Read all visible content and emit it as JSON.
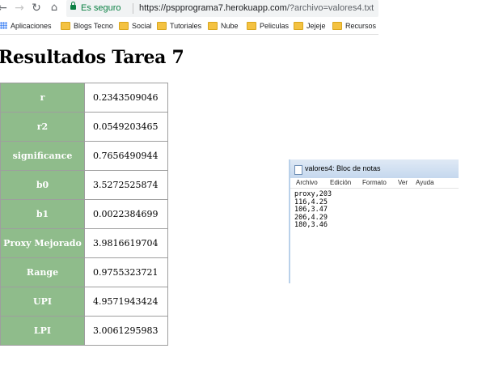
{
  "browser": {
    "security_text": "Es seguro",
    "url_host": "https://pspprograma7.herokuapp.com",
    "url_rest": "/?archivo=valores4.txt"
  },
  "bookmarks": [
    {
      "label": "Aplicaciones",
      "icon": "apps-icon"
    },
    {
      "label": "Blogs Tecno",
      "icon": "folder-icon"
    },
    {
      "label": "Social",
      "icon": "folder-icon"
    },
    {
      "label": "Tutoriales",
      "icon": "folder-icon"
    },
    {
      "label": "Nube",
      "icon": "folder-icon"
    },
    {
      "label": "Peliculas",
      "icon": "folder-icon"
    },
    {
      "label": "Jejeje",
      "icon": "folder-icon"
    },
    {
      "label": "Recursos",
      "icon": "folder-icon"
    }
  ],
  "page": {
    "title": "Resultados Tarea 7"
  },
  "results": [
    {
      "label": "r",
      "value": "0.2343509046"
    },
    {
      "label": "r2",
      "value": "0.0549203465"
    },
    {
      "label": "significance",
      "value": "0.7656490944"
    },
    {
      "label": "b0",
      "value": "3.5272525874"
    },
    {
      "label": "b1",
      "value": "0.0022384699"
    },
    {
      "label": "Proxy Mejorado",
      "value": "3.9816619704"
    },
    {
      "label": "Range",
      "value": "0.9755323721"
    },
    {
      "label": "UPI",
      "value": "4.9571943424"
    },
    {
      "label": "LPI",
      "value": "3.0061295983"
    }
  ],
  "notepad": {
    "title": "valores4: Bloc de notas",
    "menu": [
      "Archivo",
      "Edición",
      "Formato",
      "Ver",
      "Ayuda"
    ],
    "lines": [
      "proxy,203",
      "116,4.25",
      "106,3.47",
      "206,4.29",
      "180,3.46"
    ]
  },
  "colors": {
    "label_cell_bg": "#8fbc8b",
    "secure_green": "#0b8043"
  }
}
